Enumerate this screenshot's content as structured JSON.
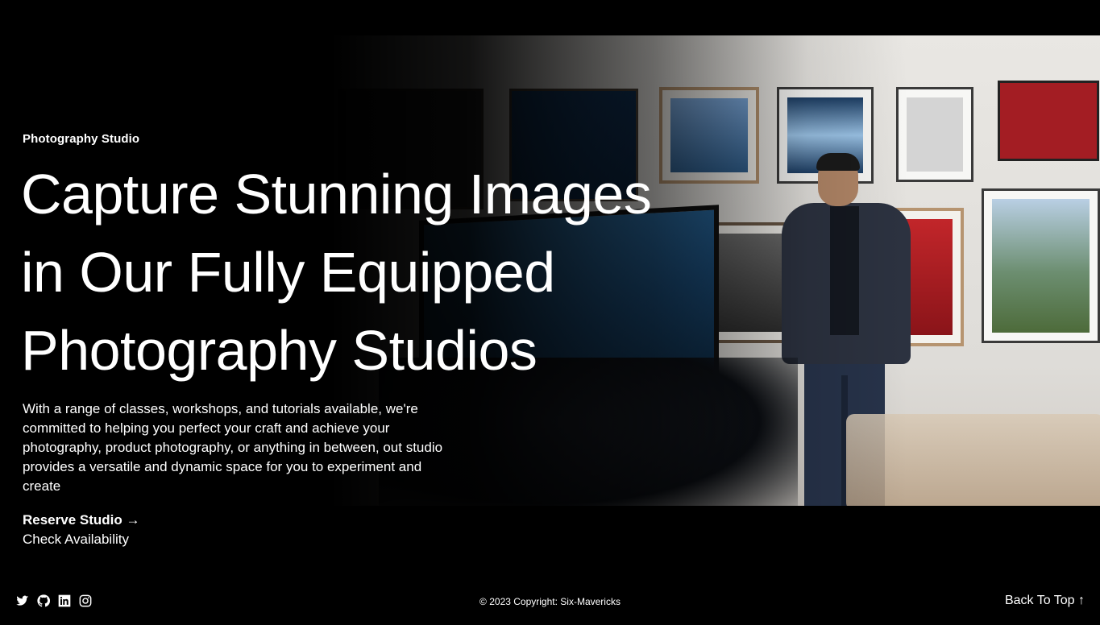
{
  "hero": {
    "eyebrow": "Photography Studio",
    "headline_lines": [
      "Capture Stunning Images",
      "in Our Fully Equipped",
      "Photography Studios"
    ],
    "description": "With a range of classes, workshops, and tutorials available, we're committed to helping you perfect your craft and achieve your photography, product photography, or anything in between, out studio provides a versatile and dynamic space for you to experiment and create",
    "primary_cta": "Reserve Studio →",
    "secondary_cta": "Check Availability"
  },
  "footer": {
    "socials": [
      "twitter-icon",
      "github-icon",
      "linkedin-icon",
      "instagram-icon"
    ],
    "copyright": "© 2023 Copyright: Six-Mavericks",
    "back_to_top": "Back To Top ↑"
  },
  "colors": {
    "background": "#000000",
    "text": "#ffffff"
  }
}
